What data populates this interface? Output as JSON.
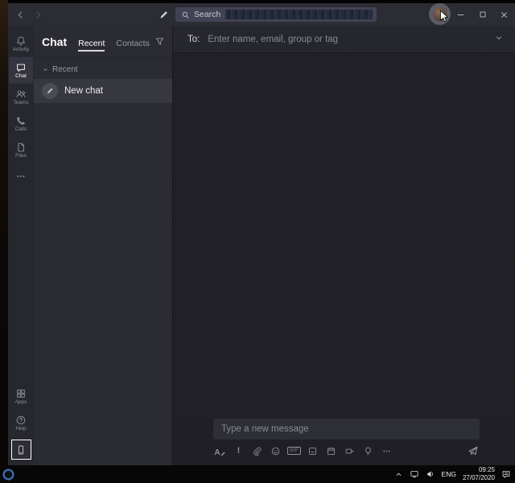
{
  "titlebar": {
    "search_placeholder": "Search"
  },
  "rail": {
    "items": [
      {
        "label": "Activity",
        "icon": "bell-icon"
      },
      {
        "label": "Chat",
        "icon": "chat-icon"
      },
      {
        "label": "Teams",
        "icon": "teams-icon"
      },
      {
        "label": "Calls",
        "icon": "calls-icon"
      },
      {
        "label": "Files",
        "icon": "files-icon"
      },
      {
        "label": "",
        "icon": "more-icon"
      }
    ],
    "apps_label": "Apps",
    "help_label": "Help"
  },
  "chat_panel": {
    "title": "Chat",
    "tabs": [
      {
        "label": "Recent"
      },
      {
        "label": "Contacts"
      }
    ],
    "section_label": "Recent",
    "items": [
      {
        "name": "New chat"
      }
    ]
  },
  "main": {
    "to_label": "To:",
    "to_placeholder": "Enter name, email, group or tag",
    "compose_placeholder": "Type a new message",
    "gif_label": "GIF"
  },
  "taskbar": {
    "language": "ENG",
    "time": "09:25",
    "date": "27/07/2020"
  },
  "colors": {
    "accent": "#6264a7",
    "titlebar": "#2c2c34",
    "rail": "#27272f",
    "panel": "#2b2b33",
    "main_bg": "#1f1f25",
    "selected_item": "#37373f"
  }
}
